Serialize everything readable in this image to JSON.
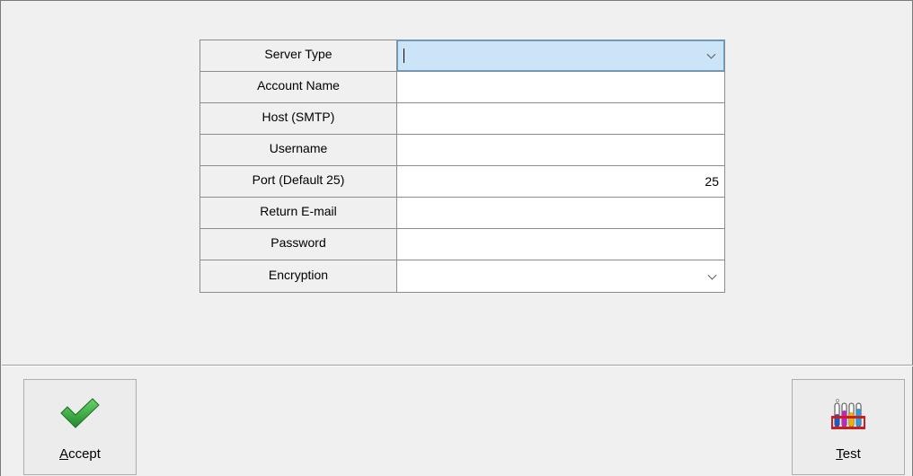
{
  "form": {
    "rows": [
      {
        "label": "Server Type",
        "value": "",
        "kind": "dropdown",
        "focused": true
      },
      {
        "label": "Account Name",
        "value": "",
        "kind": "text"
      },
      {
        "label": "Host (SMTP)",
        "value": "",
        "kind": "text"
      },
      {
        "label": "Username",
        "value": "",
        "kind": "text"
      },
      {
        "label": "Port (Default 25)",
        "value": "25",
        "kind": "number"
      },
      {
        "label": "Return E-mail",
        "value": "",
        "kind": "text"
      },
      {
        "label": "Password",
        "value": "",
        "kind": "password"
      },
      {
        "label": "Encryption",
        "value": "",
        "kind": "dropdown"
      }
    ]
  },
  "buttons": {
    "accept": {
      "mnemonic": "A",
      "rest": "ccept",
      "icon": "checkmark-icon",
      "color": "#2e9c3c"
    },
    "test": {
      "mnemonic": "T",
      "rest": "est",
      "icon": "test-tubes-icon",
      "color": "#d01c1c"
    }
  }
}
